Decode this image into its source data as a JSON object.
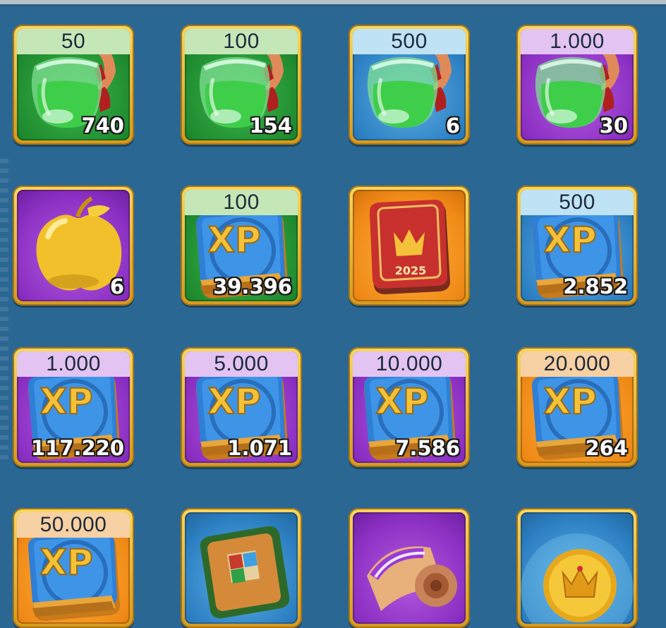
{
  "items": [
    {
      "id": "potion-50",
      "caption": "50",
      "count": "740",
      "icon": "green-potion-flask-icon",
      "bg": "green"
    },
    {
      "id": "potion-100",
      "caption": "100",
      "count": "154",
      "icon": "green-potion-flask-icon",
      "bg": "green"
    },
    {
      "id": "potion-500",
      "caption": "500",
      "count": "6",
      "icon": "green-potion-flask-icon",
      "bg": "blue"
    },
    {
      "id": "potion-1000",
      "caption": "1.000",
      "count": "30",
      "icon": "green-potion-flask-icon",
      "bg": "purple"
    },
    {
      "id": "golden-apple",
      "caption": "",
      "count": "6",
      "icon": "golden-apple-icon",
      "bg": "purple"
    },
    {
      "id": "xp-book-100",
      "caption": "100",
      "count": "39.396",
      "icon": "xp-book-icon",
      "bg": "green"
    },
    {
      "id": "crown-book-2025",
      "caption": "",
      "count": "",
      "icon": "red-crown-book-icon",
      "bg": "orange",
      "book_year": "2025"
    },
    {
      "id": "xp-book-500",
      "caption": "500",
      "count": "2.852",
      "icon": "xp-book-icon",
      "bg": "blue"
    },
    {
      "id": "xp-book-1000",
      "caption": "1.000",
      "count": "117.220",
      "icon": "xp-book-icon",
      "bg": "purple"
    },
    {
      "id": "xp-book-5000",
      "caption": "5.000",
      "count": "1.071",
      "icon": "xp-book-icon",
      "bg": "purple"
    },
    {
      "id": "xp-book-10000",
      "caption": "10.000",
      "count": "7.586",
      "icon": "xp-book-icon",
      "bg": "purple"
    },
    {
      "id": "xp-book-20000",
      "caption": "20.000",
      "count": "264",
      "icon": "xp-book-icon",
      "bg": "orange"
    },
    {
      "id": "xp-book-50000",
      "caption": "50.000",
      "count": "",
      "icon": "xp-book-icon",
      "bg": "orange"
    },
    {
      "id": "talent-book",
      "caption": "",
      "count": "",
      "icon": "talent-skill-book-icon",
      "bg": "blue"
    },
    {
      "id": "scroll",
      "caption": "",
      "count": "",
      "icon": "scroll-icon",
      "bg": "purple"
    },
    {
      "id": "gold-crown-medal",
      "caption": "",
      "count": "",
      "icon": "gold-crown-medal-icon",
      "bg": "blue"
    }
  ],
  "colors": {
    "background": "#2b6793",
    "frame": "#e8b93a",
    "green": "#1f8b2f",
    "blue": "#2c7fc2",
    "purple": "#8a2fc2",
    "orange": "#f08a17"
  }
}
